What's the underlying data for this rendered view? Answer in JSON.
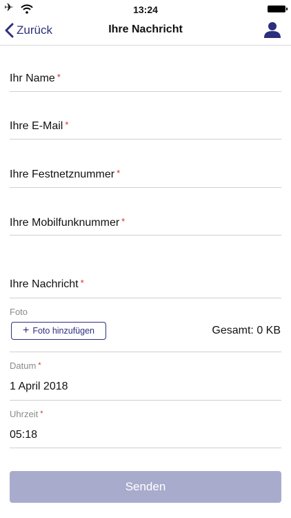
{
  "status_bar": {
    "time": "13:24",
    "airplane_icon": "airplane-icon",
    "wifi_icon": "wifi-icon",
    "battery_icon": "battery-icon"
  },
  "nav": {
    "back_label": "Zurück",
    "title": "Ihre Nachricht",
    "back_icon": "chevron-left-icon",
    "profile_icon": "person-icon"
  },
  "form": {
    "name_label": "Ihr Name",
    "email_label": "Ihre E-Mail",
    "landline_label": "Ihre Festnetznummer",
    "mobile_label": "Ihre Mobilfunknummer",
    "message_label": "Ihre Nachricht",
    "required_marker": "*",
    "photo_label": "Foto",
    "add_photo_label": "Foto hinzufügen",
    "total_size": "Gesamt: 0 KB",
    "date_label": "Datum",
    "date_value": "1 April 2018",
    "time_label": "Uhrzeit",
    "time_value": "05:18",
    "send_label": "Senden"
  },
  "colors": {
    "accent": "#2b2f7c",
    "required": "#d32f2f",
    "button_disabled": "#a9abcd"
  }
}
